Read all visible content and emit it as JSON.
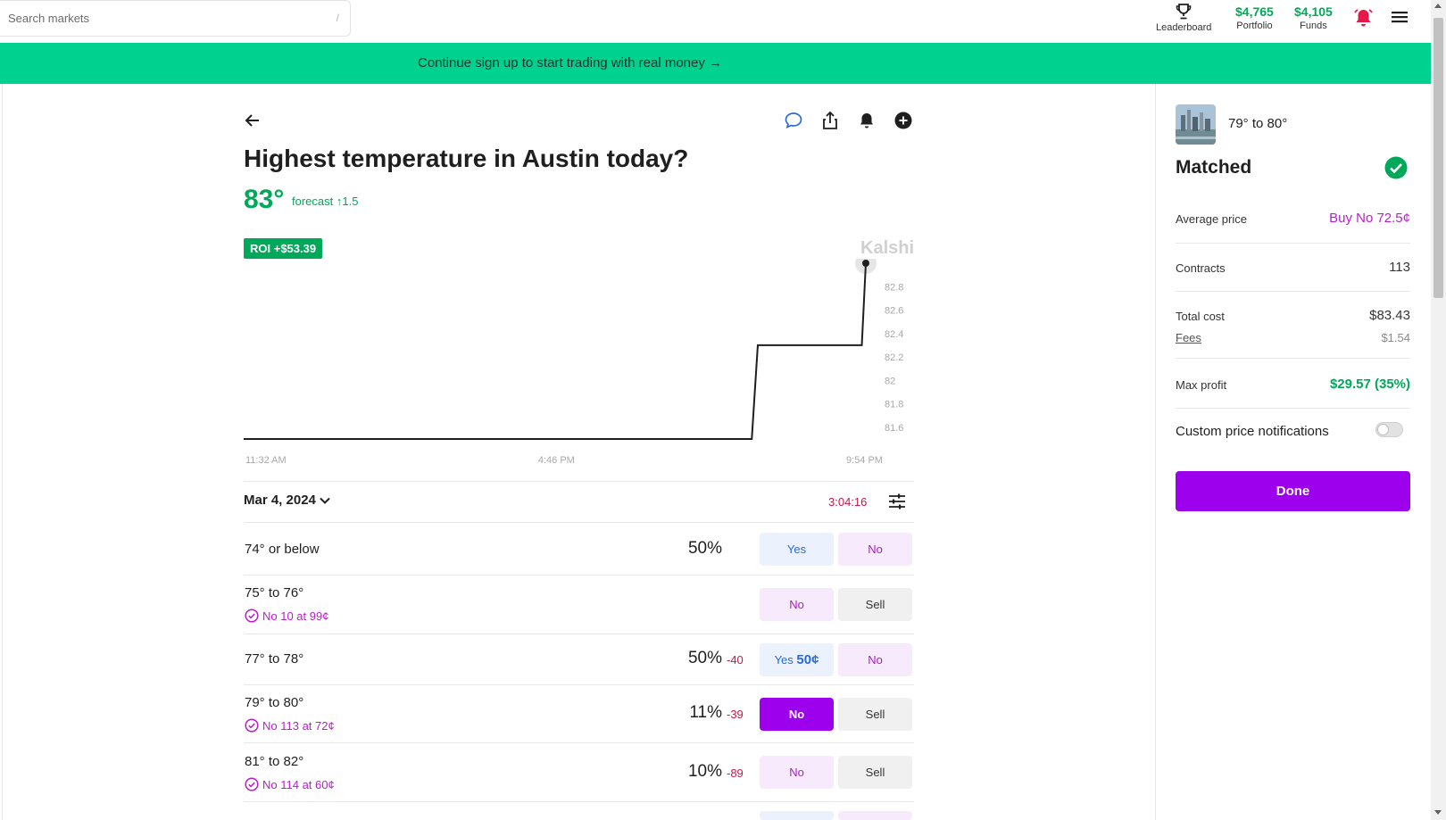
{
  "search": {
    "placeholder": "Search markets",
    "shortcut": "/"
  },
  "nav": {
    "leaderboard_label": "Leaderboard",
    "portfolio_value": "$4,765",
    "portfolio_label": "Portfolio",
    "funds_value": "$4,105",
    "funds_label": "Funds"
  },
  "banner": {
    "text": "Continue sign up to start trading with real money →"
  },
  "market": {
    "title": "Highest temperature in Austin today?",
    "current_temp": "83°",
    "forecast_text": "forecast ↑1.5",
    "roi": "ROI +$53.39",
    "brand": "Kalshi",
    "date": "Mar 4, 2024",
    "timer": "3:04:16"
  },
  "chart_data": {
    "type": "line",
    "x_tick_labels": [
      "11:32 AM",
      "4:46 PM",
      "9:54 PM"
    ],
    "y_tick_labels": [
      "82.8",
      "82.6",
      "82.4",
      "82.2",
      "82",
      "81.8",
      "81.6"
    ],
    "series": [
      {
        "points": [
          {
            "x": "11:32 AM",
            "y": 81.5
          },
          {
            "x": "8:00 PM",
            "y": 81.5
          },
          {
            "x": "8:06 PM",
            "y": 82.3
          },
          {
            "x": "9:50 PM",
            "y": 82.3
          },
          {
            "x": "9:54 PM",
            "y": 83.0
          }
        ]
      }
    ],
    "ylim": [
      81.5,
      83.0
    ],
    "grid": false
  },
  "rows": [
    {
      "label": "74° or below",
      "sub": "",
      "pct": "50%",
      "change": "",
      "btn1": "Yes",
      "btn1_price": "",
      "btn2": "No"
    },
    {
      "label": "75° to 76°",
      "sub": "No 10 at 99¢",
      "pct": "",
      "change": "",
      "btn1": "No",
      "btn1_price": "",
      "btn2": "Sell"
    },
    {
      "label": "77° to 78°",
      "sub": "",
      "pct": "50%",
      "change": "-40",
      "btn1": "Yes",
      "btn1_price": "50¢",
      "btn2": "No"
    },
    {
      "label": "79° to 80°",
      "sub": "No 113 at 72¢",
      "pct": "11%",
      "change": "-39",
      "btn1": "No",
      "btn1_price": "",
      "btn2": "Sell"
    },
    {
      "label": "81° to 82°",
      "sub": "No 114 at 60¢",
      "pct": "10%",
      "change": "-89",
      "btn1": "No",
      "btn1_price": "",
      "btn2": "Sell"
    }
  ],
  "order": {
    "market_name": "79° to 80°",
    "status": "Matched",
    "avg_price_label": "Average price",
    "avg_price_value": "Buy No 72.5¢",
    "contracts_label": "Contracts",
    "contracts_value": "113",
    "total_cost_label": "Total cost",
    "total_cost_value": "$83.43",
    "fees_label": "Fees",
    "fees_value": "$1.54",
    "max_profit_label": "Max profit",
    "max_profit_value": "$29.57 (35%)",
    "notifications_label": "Custom price notifications",
    "notifications_on": false,
    "done_label": "Done"
  },
  "colors": {
    "accent_green": "#00a85a",
    "banner_green": "#00d18f",
    "purple": "#9d00ec",
    "red": "#c6174a",
    "blue": "#2a6bd6"
  }
}
